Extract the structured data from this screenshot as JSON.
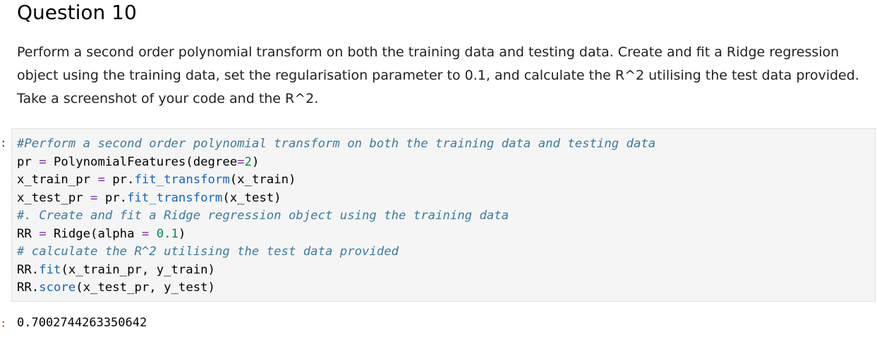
{
  "heading": "Question 10",
  "prose": "Perform a second order polynomial transform on both the training data and testing data. Create and fit a Ridge regression object using the training data, set the regularisation parameter to 0.1, and calculate the R^2 utilising the test data provided. Take a screenshot of your code and the R^2.",
  "cell": {
    "in_prompt": ":",
    "out_prompt": ":",
    "code": {
      "l1_comment": "#Perform a second order polynomial transform on both the training data and testing data",
      "l2_a": "pr ",
      "l2_eq": "=",
      "l2_b": " PolynomialFeatures(degree",
      "l2_eq2": "=",
      "l2_num": "2",
      "l2_c": ")",
      "l3_a": "x_train_pr ",
      "l3_eq": "=",
      "l3_b": " pr.",
      "l3_attr": "fit_transform",
      "l3_c": "(x_train)",
      "l4_a": "x_test_pr ",
      "l4_eq": "=",
      "l4_b": " pr.",
      "l4_attr": "fit_transform",
      "l4_c": "(x_test)",
      "l5_comment": "#. Create and fit a Ridge regression object using the training data",
      "l6_a": "RR ",
      "l6_eq": "=",
      "l6_b": " Ridge(alpha ",
      "l6_eq2": "=",
      "l6_sp": " ",
      "l6_num": "0.1",
      "l6_c": ")",
      "l7_comment": "# calculate the R^2 utilising the test data provided",
      "l8_a": "RR.",
      "l8_attr": "fit",
      "l8_c": "(x_train_pr, y_train)",
      "l9_a": "RR.",
      "l9_attr": "score",
      "l9_c": "(x_test_pr, y_test)"
    },
    "output": "0.7002744263350642"
  }
}
